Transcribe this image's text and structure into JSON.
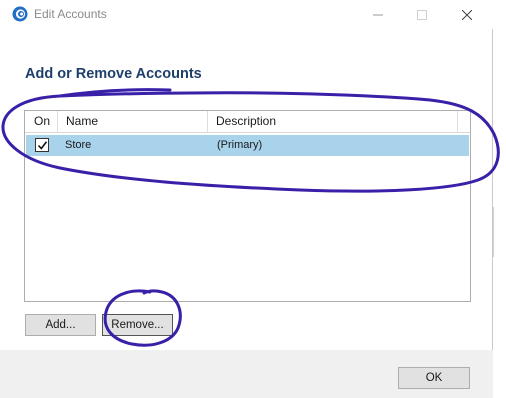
{
  "window": {
    "title": "Edit Accounts"
  },
  "icons": {
    "app": "app-logo-icon",
    "minimize": "minimize-icon",
    "maximize": "maximize-icon",
    "close": "close-icon",
    "check": "checkmark-icon"
  },
  "main": {
    "heading": "Add or Remove Accounts",
    "columns": [
      "On",
      "Name",
      "Description"
    ],
    "rows": [
      {
        "on": true,
        "name": "Store",
        "description": "(Primary)"
      }
    ]
  },
  "buttons": {
    "add": "Add...",
    "remove": "Remove...",
    "ok": "OK"
  },
  "colors": {
    "heading": "#1e3f6a",
    "selected_row": "#a9d3ea",
    "annotation": "#3a1fa8"
  }
}
